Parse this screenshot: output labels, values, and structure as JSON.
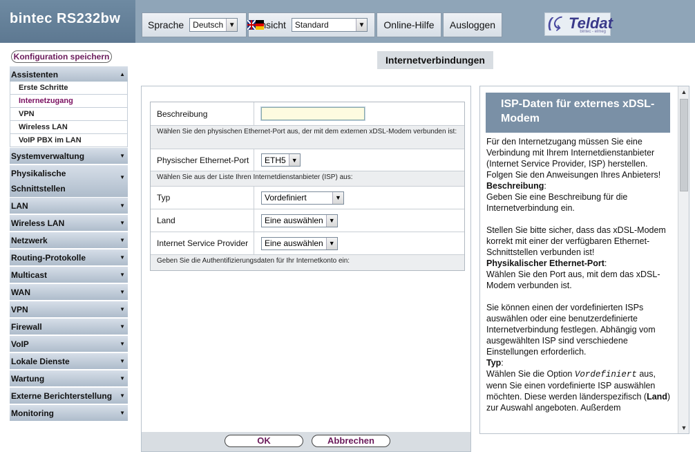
{
  "header": {
    "brand": "bintec  RS232bw",
    "language_label": "Sprache",
    "language_value": "Deutsch",
    "view_label": "Ansicht",
    "view_value": "Standard",
    "help_button": "Online-Hilfe",
    "logout_button": "Ausloggen",
    "logo_text": "Teldat",
    "logo_sub": "bintec - elmeg"
  },
  "sidebar": {
    "save_button": "Konfiguration speichern",
    "sections": [
      {
        "label": "Assistenten"
      },
      {
        "label": "Systemverwaltung"
      },
      {
        "label": "Physikalische Schnittstellen"
      },
      {
        "label": "LAN"
      },
      {
        "label": "Wireless LAN"
      },
      {
        "label": "Netzwerk"
      },
      {
        "label": "Routing-Protokolle"
      },
      {
        "label": "Multicast"
      },
      {
        "label": "WAN"
      },
      {
        "label": "VPN"
      },
      {
        "label": "Firewall"
      },
      {
        "label": "VoIP"
      },
      {
        "label": "Lokale Dienste"
      },
      {
        "label": "Wartung"
      },
      {
        "label": "Externe Berichterstellung"
      },
      {
        "label": "Monitoring"
      }
    ],
    "assistant_items": [
      {
        "label": "Erste Schritte"
      },
      {
        "label": "Internetzugang"
      },
      {
        "label": "VPN"
      },
      {
        "label": "Wireless LAN"
      },
      {
        "label": "VoIP PBX im LAN"
      }
    ]
  },
  "main": {
    "title": "Internetverbindungen",
    "form": {
      "description_label": "Beschreibung",
      "description_value": "",
      "hint_port": "Wählen Sie den physischen Ethernet-Port aus, der mit dem externen xDSL-Modem verbunden ist:",
      "port_label": "Physischer Ethernet-Port",
      "port_value": "ETH5",
      "hint_isp": "Wählen Sie aus der Liste Ihren Internetdienstanbieter (ISP) aus:",
      "type_label": "Typ",
      "type_value": "Vordefiniert",
      "country_label": "Land",
      "country_value": "Eine auswählen",
      "isp_label": "Internet Service Provider",
      "isp_value": "Eine auswählen",
      "hint_auth": "Geben Sie die Authentifizierungsdaten für Ihr Internetkonto ein:"
    },
    "ok_button": "OK",
    "cancel_button": "Abbrechen"
  },
  "help": {
    "title": "ISP-Daten für externes xDSL-Modem",
    "p1": "Für den Internetzugang müssen Sie eine Verbindung mit Ihrem Internetdienstanbieter (Internet Service Provider, ISP) herstellen.",
    "p2": "Folgen Sie den Anweisungen Ihres Anbieters!",
    "h_desc": "Beschreibung",
    "p3": "Geben Sie eine Beschreibung für die Internetverbindung ein.",
    "p4": "Stellen Sie bitte sicher, dass das xDSL-Modem korrekt mit einer der verfügbaren Ethernet-Schnittstellen verbunden ist!",
    "h_port": "Physikalischer Ethernet-Port",
    "p5": "Wählen Sie den Port aus, mit dem das xDSL-Modem verbunden ist.",
    "p6": "Sie können einen der vordefinierten ISPs auswählen oder eine benutzerdefinierte Internetverbindung festlegen. Abhängig vom ausgewählten ISP sind verschiedene Einstellungen erforderlich.",
    "h_type": "Typ",
    "p7a": "Wählen Sie die Option ",
    "p7mono": "Vordefiniert",
    "p7b": " aus, wenn Sie einen vordefinierte ISP auswählen möchten. Diese werden länderspezifisch (",
    "p7land": "Land",
    "p7c": ") zur Auswahl angeboten. Außerdem"
  }
}
